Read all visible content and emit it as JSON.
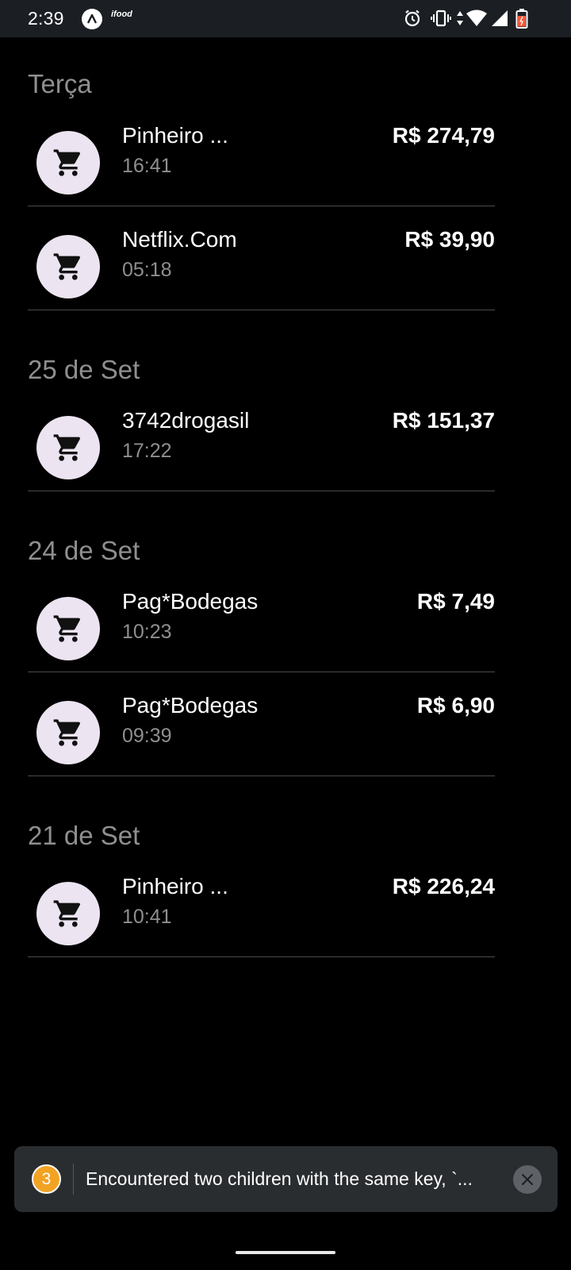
{
  "status_bar": {
    "time": "2:39",
    "ifood_label": "ifood"
  },
  "sections": [
    {
      "header": "Terça",
      "transactions": [
        {
          "merchant": "Pinheiro ...",
          "time": "16:41",
          "amount": "R$ 274,79",
          "icon": "cart-icon"
        },
        {
          "merchant": "Netflix.Com",
          "time": "05:18",
          "amount": "R$ 39,90",
          "icon": "cart-icon"
        }
      ]
    },
    {
      "header": "25 de Set",
      "transactions": [
        {
          "merchant": "3742drogasil",
          "time": "17:22",
          "amount": "R$ 151,37",
          "icon": "cart-icon"
        }
      ]
    },
    {
      "header": "24 de Set",
      "transactions": [
        {
          "merchant": "Pag*Bodegas",
          "time": "10:23",
          "amount": "R$ 7,49",
          "icon": "cart-icon"
        },
        {
          "merchant": "Pag*Bodegas",
          "time": "09:39",
          "amount": "R$ 6,90",
          "icon": "cart-icon"
        }
      ]
    },
    {
      "header": "21 de Set",
      "transactions": [
        {
          "merchant": "Pinheiro ...",
          "time": "10:41",
          "amount": "R$ 226,24",
          "icon": "cart-icon"
        }
      ]
    }
  ],
  "toast": {
    "count": "3",
    "message": "Encountered two children with the same key, `..."
  },
  "colors": {
    "background": "#000000",
    "avatar_bg": "#ece4f1",
    "secondary_text": "#8f8f8f",
    "divider": "#4a4a4a",
    "toast_bg": "#2a2d30",
    "badge": "#f2a324"
  }
}
